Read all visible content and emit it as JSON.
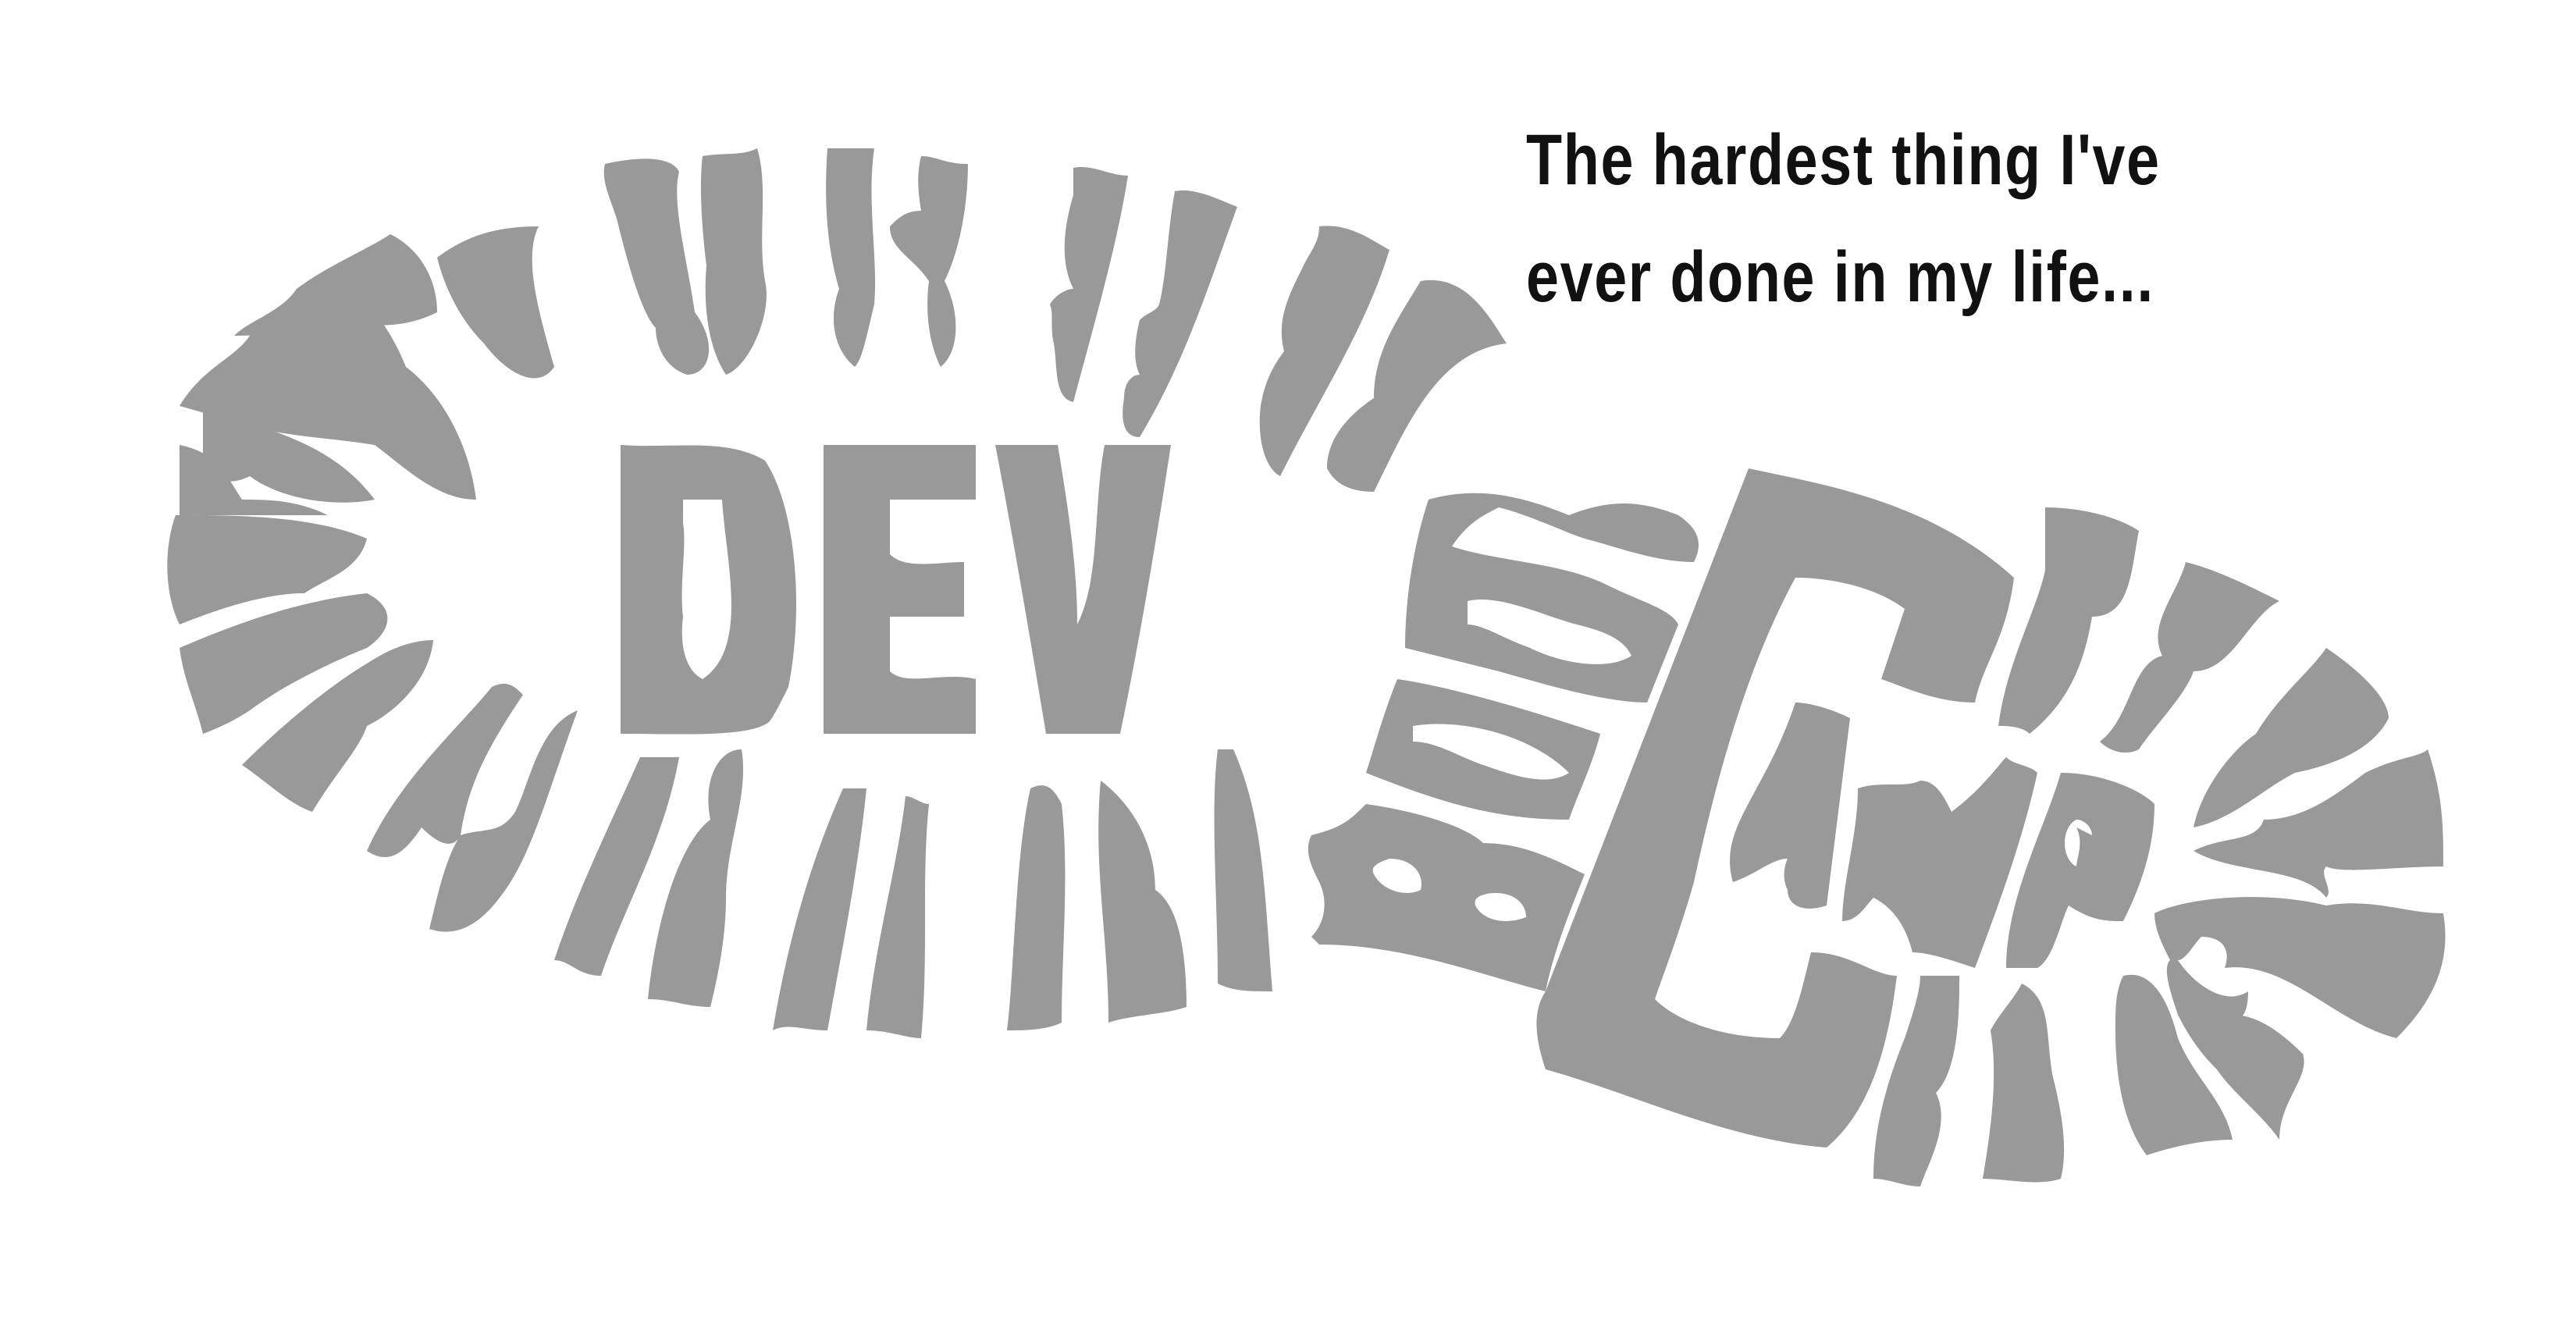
{
  "logo": {
    "word_primary": "DEV",
    "word_secondary": "BOOT",
    "word_tertiary": "CAMP",
    "fill_color": "#999999"
  },
  "tagline": {
    "line1": "The hardest thing I've",
    "line2": "ever done in my life...",
    "text_color": "#111111"
  },
  "background_color": "#ffffff"
}
